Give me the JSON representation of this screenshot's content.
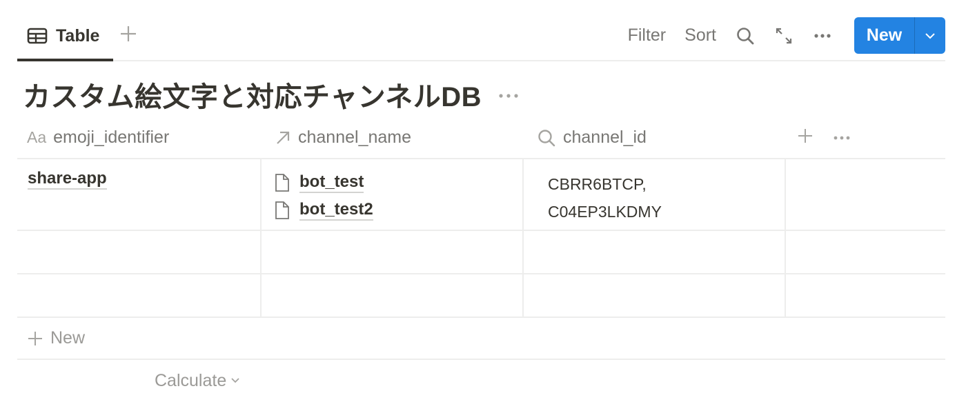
{
  "view_tabs": [
    {
      "label": "Table",
      "icon": "table-icon",
      "active": true
    }
  ],
  "toolbar": {
    "add_view_icon": "plus-icon",
    "filter_label": "Filter",
    "sort_label": "Sort",
    "search_icon": "search-icon",
    "expand_icon": "expand-icon",
    "more_icon": "more-icon",
    "new_label": "New",
    "new_caret_icon": "chevron-down-icon",
    "accent_color": "#2383e2"
  },
  "database": {
    "title": "カスタム絵文字と対応チャンネルDB"
  },
  "table": {
    "columns": [
      {
        "label": "emoji_identifier",
        "icon": "Aa",
        "type": "title"
      },
      {
        "label": "channel_name",
        "icon": "arrow-up-right-icon",
        "type": "relation"
      },
      {
        "label": "channel_id",
        "icon": "search-icon",
        "type": "rollup"
      }
    ],
    "rows": [
      {
        "emoji_identifier": "share-app",
        "channel_name": [
          "bot_test",
          "bot_test2"
        ],
        "channel_id": [
          "CBRR6BTCP,",
          "C04EP3LKDMY"
        ]
      },
      {
        "emoji_identifier": "",
        "channel_name": [],
        "channel_id": []
      },
      {
        "emoji_identifier": "",
        "channel_name": [],
        "channel_id": []
      }
    ],
    "new_row_label": "New",
    "calculate_label": "Calculate"
  }
}
